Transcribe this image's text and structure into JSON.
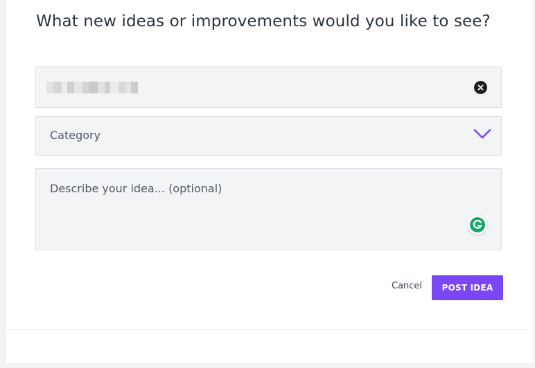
{
  "form": {
    "heading": "What new ideas or improvements would you like to see?",
    "title_input": {
      "value": "",
      "redacted": true
    },
    "category": {
      "label": "Category"
    },
    "description": {
      "placeholder": "Describe your idea... (optional)",
      "value": ""
    }
  },
  "actions": {
    "cancel_label": "Cancel",
    "post_label": "POST IDEA"
  },
  "icons": {
    "clear": "close-circle-icon",
    "category_toggle": "chevron-down-icon",
    "grammarly": "grammarly-icon"
  },
  "colors": {
    "accent": "#7b47f5",
    "heading_text": "#2a3440",
    "field_background": "#f3f4f6",
    "grammarly_green": "#15a66a"
  }
}
